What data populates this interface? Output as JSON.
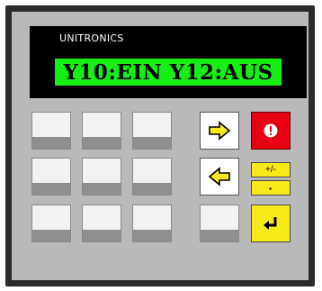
{
  "device": {
    "brand": "UNITRONICS",
    "display_text": "Y10:EIN Y12:AUS"
  },
  "keys": {
    "blank_icon": "blank-key",
    "right_arrow_icon": "right-arrow-icon",
    "left_arrow_icon": "left-arrow-icon",
    "info_icon": "exclamation-icon",
    "enter_icon": "enter-icon",
    "plus_minus_label": "+/-",
    "dot_label": "·"
  },
  "colors": {
    "lcd_background": "#16ef16",
    "panel": "#b9b9b9",
    "red_key": "#e60012",
    "yellow_key": "#f7ea1a"
  }
}
